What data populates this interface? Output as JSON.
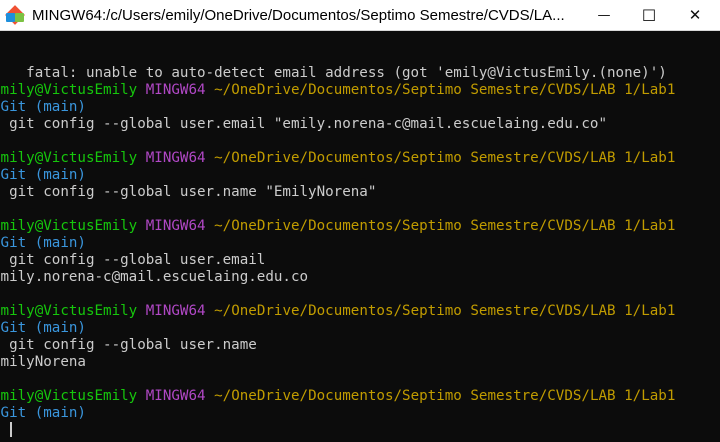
{
  "window": {
    "title": "MINGW64:/c/Users/emily/OneDrive/Documentos/Septimo Semestre/CVDS/LA...",
    "minimize_symbol": "—",
    "maximize_symbol": "☐",
    "close_symbol": "✕"
  },
  "colors": {
    "user_host": "#16c60c",
    "msystem": "#b148c6",
    "path": "#c19c00",
    "branch": "#3a96dd",
    "text": "#cccccc",
    "background": "#0c0c0c"
  },
  "terminal": {
    "error_line": "fatal: unable to auto-detect email address (got 'emily@VictusEmily.(none)')",
    "prompt": {
      "user_host": "emily@VictusEmily",
      "msystem": "MINGW64",
      "path": "~/OneDrive/Documentos/Septimo Semestre/CVDS/LAB 1/Lab1",
      "vcs": "-Git",
      "branch": "(main)",
      "symbol": "$"
    },
    "commands": [
      "git config --global user.email \"emily.norena-c@mail.escuelaing.edu.co\"",
      "git config --global user.name \"EmilyNorena\"",
      "git config --global user.email",
      "git config --global user.name"
    ],
    "outputs": [
      "emily.norena-c@mail.escuelaing.edu.co",
      "EmilyNorena"
    ]
  }
}
